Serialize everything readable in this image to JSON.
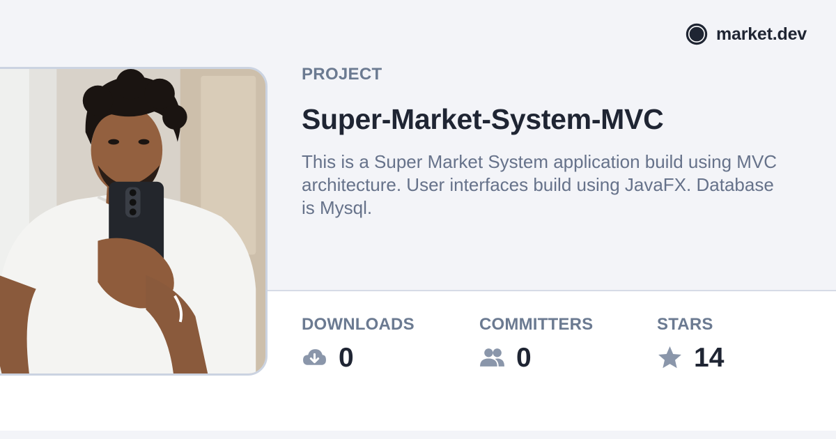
{
  "brand": {
    "name": "market.dev",
    "logo_icon": "filled-circle-logo-icon"
  },
  "project": {
    "eyebrow": "PROJECT",
    "title": "Super-Market-System-MVC",
    "description": "This is a Super Market System application build using MVC architecture. User interfaces build using JavaFX. Database is Mysql."
  },
  "avatar": {
    "icon": "user-photo"
  },
  "stats": {
    "downloads": {
      "label": "DOWNLOADS",
      "value": "0",
      "icon": "cloud-download-icon"
    },
    "committers": {
      "label": "COMMITTERS",
      "value": "0",
      "icon": "users-icon"
    },
    "stars": {
      "label": "STARS",
      "value": "14",
      "icon": "star-icon"
    }
  },
  "colors": {
    "background": "#f3f4f8",
    "panel": "#ffffff",
    "text_primary": "#1f2533",
    "text_muted": "#6b7a91",
    "icon_muted": "#8a96aa",
    "border": "#d6dbe6"
  }
}
